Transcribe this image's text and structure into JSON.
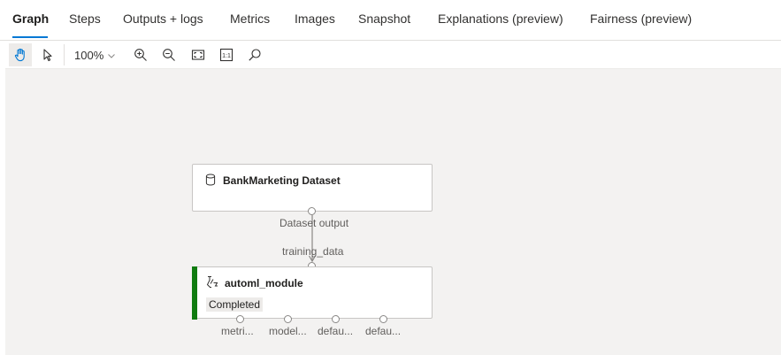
{
  "tabs": [
    {
      "label": "Graph"
    },
    {
      "label": "Steps"
    },
    {
      "label": "Outputs + logs"
    },
    {
      "label": "Metrics"
    },
    {
      "label": "Images"
    },
    {
      "label": "Snapshot"
    },
    {
      "label": "Explanations (preview)"
    },
    {
      "label": "Fairness (preview)"
    }
  ],
  "active_tab": "Graph",
  "toolbar": {
    "zoom_level": "100%",
    "tools": [
      "hand-icon",
      "pointer-icon",
      "zoom-in-icon",
      "zoom-out-icon",
      "fit-screen-icon",
      "actual-size-icon",
      "search-icon"
    ],
    "actual_size_label": "1:1"
  },
  "graph": {
    "dataset_node": {
      "title": "BankMarketing Dataset",
      "output_port_label": "Dataset output"
    },
    "connection_input_label": "training_data",
    "module_node": {
      "title": "automl_module",
      "status": "Completed",
      "status_color": "#107c10",
      "output_ports": [
        "metri...",
        "model...",
        "defau...",
        "defau..."
      ]
    }
  },
  "colors": {
    "accent": "#0078d4",
    "canvas": "#f3f2f1",
    "success": "#107c10"
  }
}
